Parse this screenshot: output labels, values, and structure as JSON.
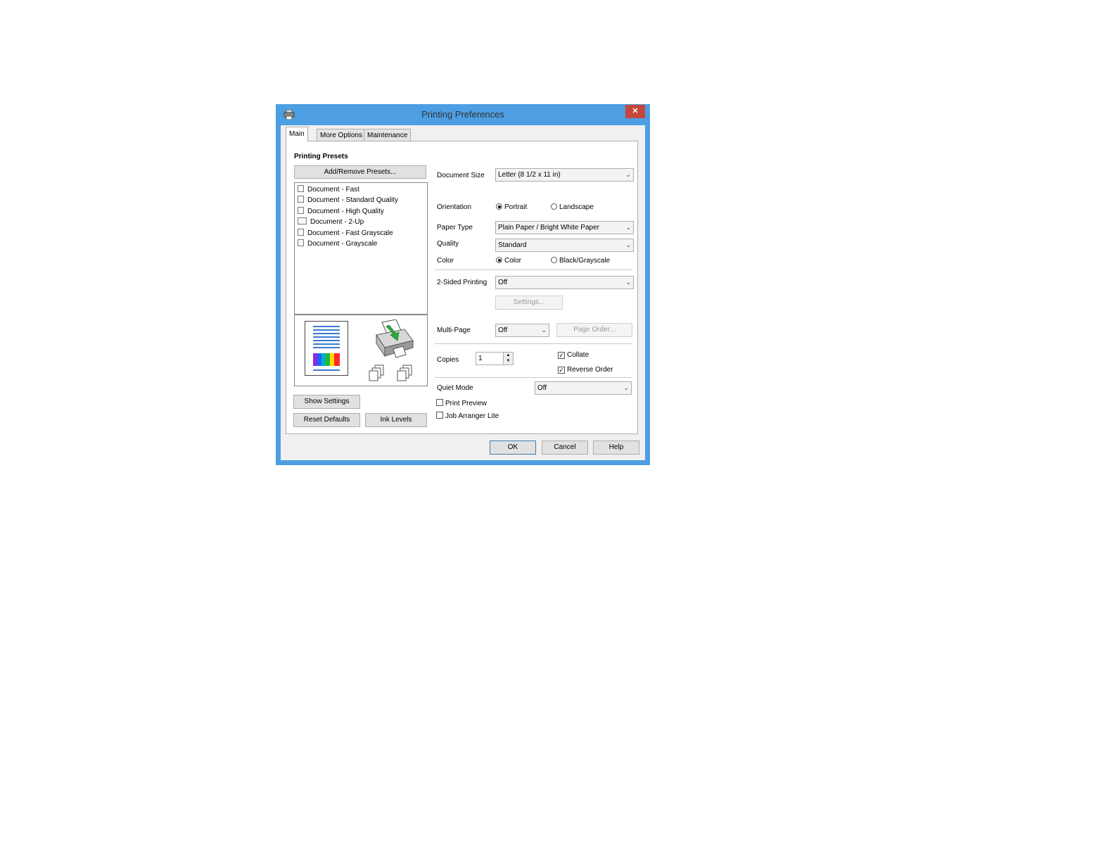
{
  "window": {
    "title": "Printing Preferences",
    "close_symbol": "✕"
  },
  "tabs": [
    "Main",
    "More Options",
    "Maintenance"
  ],
  "presets": {
    "heading": "Printing Presets",
    "add_remove_label": "Add/Remove Presets...",
    "items": [
      "Document - Fast",
      "Document - Standard Quality",
      "Document - High Quality",
      "Document - 2-Up",
      "Document - Fast Grayscale",
      "Document - Grayscale"
    ]
  },
  "left_buttons": {
    "show_settings": "Show Settings",
    "reset_defaults": "Reset Defaults",
    "ink_levels": "Ink Levels"
  },
  "settings": {
    "document_size_label": "Document Size",
    "document_size_value": "Letter (8 1/2 x 11 in)",
    "orientation_label": "Orientation",
    "portrait_label": "Portrait",
    "landscape_label": "Landscape",
    "orientation_selected": "Portrait",
    "paper_type_label": "Paper Type",
    "paper_type_value": "Plain Paper / Bright White Paper",
    "quality_label": "Quality",
    "quality_value": "Standard",
    "color_label": "Color",
    "color_option": "Color",
    "grayscale_option": "Black/Grayscale",
    "color_selected": "Color",
    "two_sided_label": "2-Sided Printing",
    "two_sided_value": "Off",
    "two_sided_settings": "Settings...",
    "multipage_label": "Multi-Page",
    "multipage_value": "Off",
    "page_order_label": "Page Order...",
    "copies_label": "Copies",
    "copies_value": "1",
    "collate_label": "Collate",
    "collate_checked": true,
    "reverse_order_label": "Reverse Order",
    "reverse_order_checked": true,
    "quiet_mode_label": "Quiet Mode",
    "quiet_mode_value": "Off",
    "print_preview_label": "Print Preview",
    "print_preview_checked": false,
    "job_arranger_label": "Job Arranger Lite",
    "job_arranger_checked": false
  },
  "footer": {
    "ok": "OK",
    "cancel": "Cancel",
    "help": "Help"
  },
  "colors": {
    "title_bar": "#4d9ee3",
    "close_button": "#c7463a",
    "arrow": "#2eaa3a"
  }
}
